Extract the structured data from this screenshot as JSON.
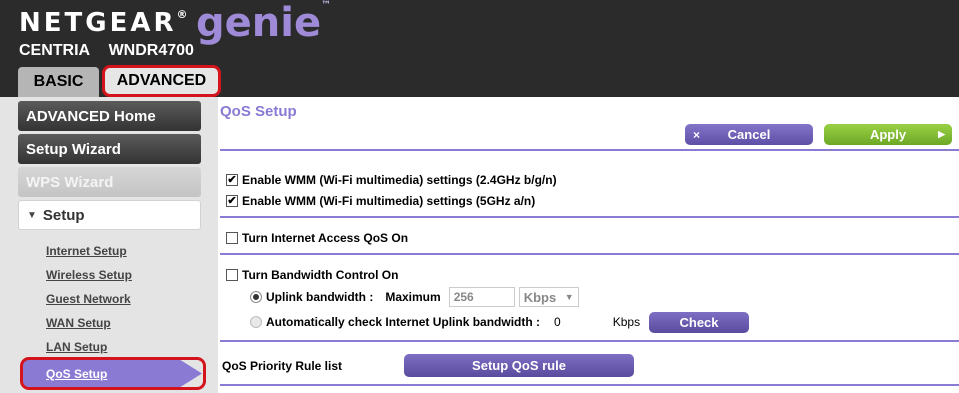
{
  "header": {
    "brand": "NETGEAR",
    "brand_mark": "®",
    "product": "genie",
    "product_mark": "™",
    "model_line1": "CENTRIA",
    "model_line2": "WNDR4700"
  },
  "tabs": [
    {
      "label": "BASIC",
      "active": false
    },
    {
      "label": "ADVANCED",
      "active": true
    }
  ],
  "sidebar": {
    "advanced_home": "ADVANCED Home",
    "setup_wizard": "Setup Wizard",
    "wps_wizard": "WPS Wizard",
    "setup_arrow": "▼",
    "setup": "Setup",
    "links": [
      "Internet Setup",
      "Wireless Setup",
      "Guest Network",
      "WAN Setup",
      "LAN Setup",
      "QoS Setup"
    ]
  },
  "main": {
    "title": "QoS Setup",
    "cancel_icon": "×",
    "cancel_label": "Cancel",
    "apply_label": "Apply",
    "apply_icon": "▶",
    "wmm_24_label": "Enable WMM (Wi-Fi multimedia) settings (2.4GHz b/g/n)",
    "wmm_24_checked": true,
    "wmm_5_label": "Enable WMM (Wi-Fi multimedia) settings (5GHz a/n)",
    "wmm_5_checked": true,
    "internet_qos_label": "Turn Internet Access QoS On",
    "internet_qos_checked": false,
    "bandwidth_control_label": "Turn Bandwidth Control On",
    "bandwidth_control_checked": false,
    "uplink_label": "Uplink bandwidth :",
    "maximum_label": "Maximum",
    "uplink_value": "256",
    "uplink_unit": "Kbps",
    "auto_check_label": "Automatically check Internet Uplink bandwidth :",
    "auto_check_value": "0",
    "auto_check_unit": "Kbps",
    "check_label": "Check",
    "priority_list_label": "QoS Priority Rule list",
    "setup_rule_label": "Setup QoS rule",
    "check_mark": "✔"
  },
  "colors": {
    "accent": "#8a7ad4",
    "apply_green": "#7cb82f",
    "highlight_red": "#d4141c",
    "header_bg": "#2b2b2b"
  }
}
